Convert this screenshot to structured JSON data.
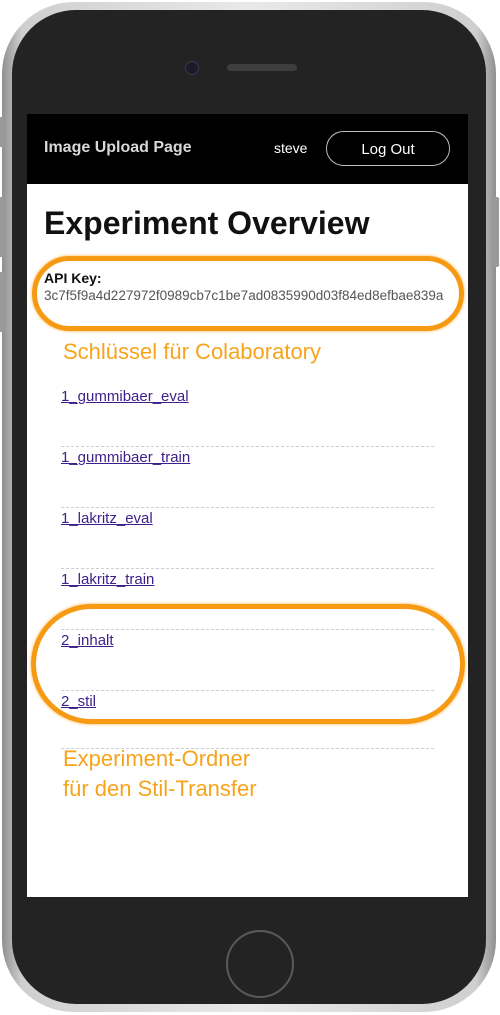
{
  "navbar": {
    "brand": "Image Upload Page",
    "username": "steve",
    "logout_label": "Log Out"
  },
  "main": {
    "title": "Experiment Overview",
    "api_key_label": "API Key:",
    "api_key_value": "3c7f5f9a4d227972f0989cb7c1be7ad0835990d03f84ed8efbae839a",
    "experiments": [
      {
        "label": "1_gummibaer_eval"
      },
      {
        "label": "1_gummibaer_train"
      },
      {
        "label": "1_lakritz_eval"
      },
      {
        "label": "1_lakritz_train"
      },
      {
        "label": "2_inhalt"
      },
      {
        "label": "2_stil"
      }
    ]
  },
  "annotations": {
    "key_note": "Schlüssel für Colaboratory",
    "folder_note_line1": "Experiment-Ordner",
    "folder_note_line2": "für den Stil-Transfer",
    "highlight_color": "#f79a13"
  }
}
